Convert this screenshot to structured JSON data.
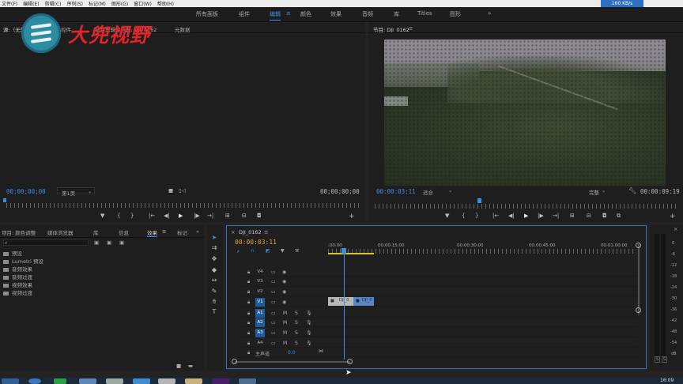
{
  "menu": [
    "文件(F)",
    "编辑(E)",
    "剪辑(C)",
    "序列(S)",
    "标记(M)",
    "图形(G)",
    "窗口(W)",
    "帮助(H)"
  ],
  "net_speed": "160 KB/s",
  "workspaces": [
    "所有面板",
    "组件",
    "编辑",
    "颜色",
    "效果",
    "音频",
    "库",
    "Titles",
    "图形"
  ],
  "workspace_more": "»",
  "watermark": "大兜视野",
  "source": {
    "tabs": [
      "源:（无剪辑）",
      "效果控件",
      "音频剪辑混合器: DJI_0162",
      "元数据"
    ],
    "timecode_left": "00;00;00;00",
    "page": "第1页",
    "timecode_right": "00;00;00;00"
  },
  "program": {
    "title": "节目: DJI_0162",
    "timecode_left": "00:00:03:11",
    "fit": "适合",
    "quality": "完整",
    "timecode_right": "00:00:09:19"
  },
  "project": {
    "tabs": [
      "项目: 颜色调整",
      "媒体浏览器",
      "库",
      "信息",
      "效果",
      "标记"
    ],
    "active_tab": "效果",
    "items": [
      "预设",
      "Lumetri 预设",
      "音频效果",
      "音频过渡",
      "视频效果",
      "视频过渡"
    ]
  },
  "timeline": {
    "sequence": "DJI_0162",
    "timecode": "00:00:03:11",
    "ruler": [
      ":00:00",
      "00:00:15:00",
      "00:00:30:00",
      "00:00:45:00",
      "00:01:00:00"
    ],
    "video_tracks": [
      "V4",
      "V3",
      "V2",
      "V1"
    ],
    "audio_tracks": [
      "A1",
      "A2",
      "A3",
      "A4"
    ],
    "master": "主声道",
    "master_value": "0.0",
    "clip_a": "DJI_0",
    "clip_b": "DJI_0"
  },
  "meter": {
    "scale": [
      "0",
      "-6",
      "-12",
      "-18",
      "-24",
      "-30",
      "-36",
      "-42",
      "-48",
      "-54",
      "dB"
    ],
    "solo": [
      "S",
      "S"
    ]
  },
  "tray_time": "16:09"
}
